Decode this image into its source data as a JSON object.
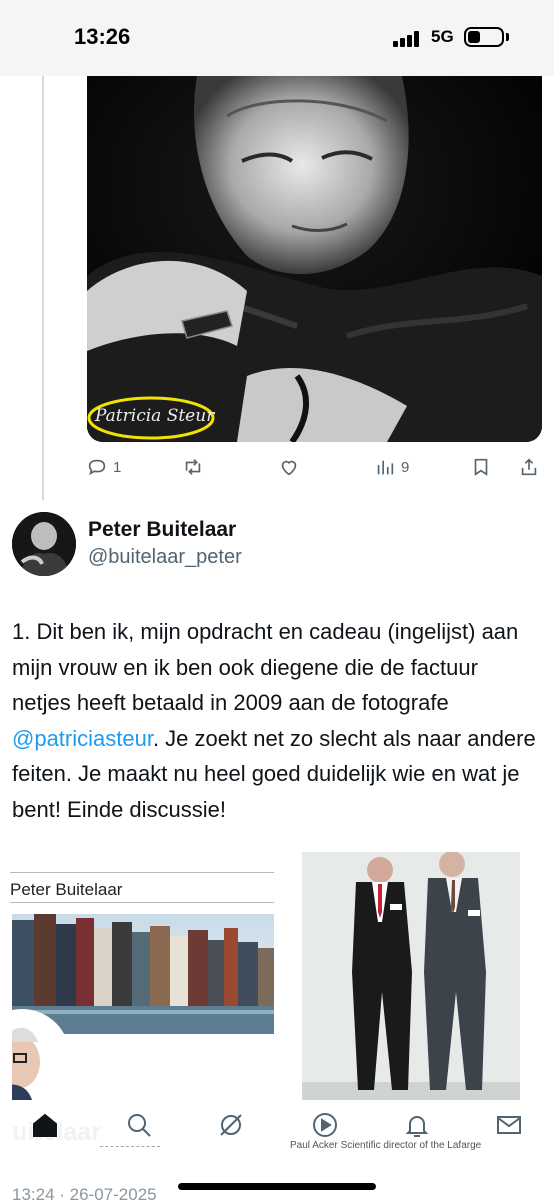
{
  "status_bar": {
    "time": "13:26",
    "network": "5G"
  },
  "tweet_above": {
    "photo_signature": "Patricia Steur",
    "actions": {
      "replies": "1",
      "views": "9"
    }
  },
  "post": {
    "author_name": "Peter Buitelaar",
    "author_handle": "@buitelaar_peter",
    "text_before": "1. Dit ben ik, mijn opdracht en cadeau (ingelijst) aan mijn vrouw en ik ben ook diegene die de factuur netjes heeft betaald in 2009 aan de fotografe ",
    "mention": "@patriciasteur",
    "text_after": ". Je zoekt net zo slecht als naar andere feiten. Je maakt nu heel goed duidelijk wie en wat je bent! Einde discussie!",
    "media_left_name": "Peter Buitelaar",
    "media_right_caption": "Paul Acker Scientific director of the Lafarge"
  },
  "bottom_overlay": {
    "ghost_name": "uitelaar",
    "timestamp": "13:24 · 26-07-2025"
  },
  "colors": {
    "accent": "#1d9bf0",
    "icon_gray": "#536471",
    "signature_circle": "#f2e200"
  },
  "icons": {
    "actions": [
      "reply-icon",
      "retweet-icon",
      "like-icon",
      "views-icon",
      "bookmark-icon",
      "share-icon"
    ],
    "tabs": [
      "home-icon",
      "search-icon",
      "grok-icon",
      "play-icon",
      "notifications-icon",
      "messages-icon"
    ]
  }
}
